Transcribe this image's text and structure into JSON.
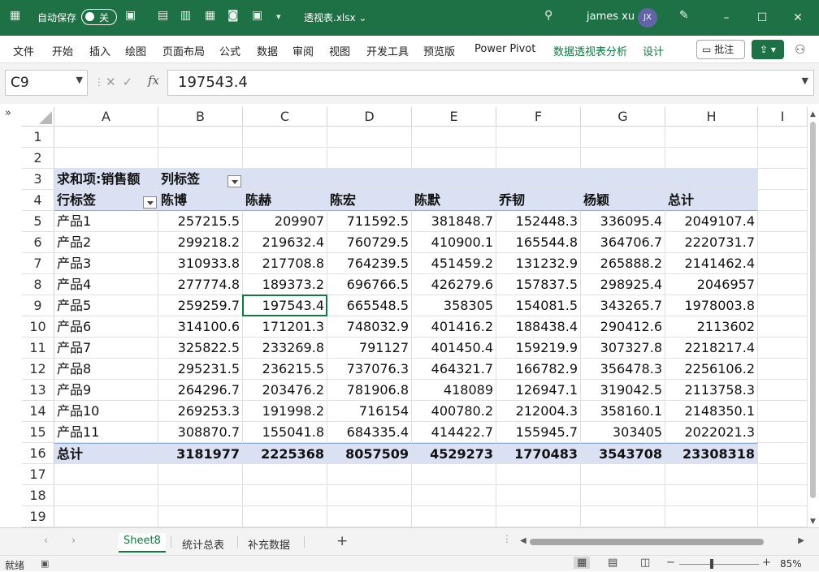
{
  "titlebar": {
    "autosave_label": "自动保存",
    "autosave_state": "关",
    "filename": "透视表.xlsx",
    "user_name": "james xu",
    "user_initials": "JX"
  },
  "ribbon": {
    "tabs": [
      "文件",
      "开始",
      "插入",
      "绘图",
      "页面布局",
      "公式",
      "数据",
      "审阅",
      "视图",
      "开发工具",
      "预览版",
      "Power Pivot"
    ],
    "context_tabs": [
      "数据透视表分析",
      "设计"
    ],
    "comment_label": "批注"
  },
  "formula_bar": {
    "name_box": "C9",
    "value": "197543.4",
    "fx_label": "fx"
  },
  "columns": [
    "A",
    "B",
    "C",
    "D",
    "E",
    "F",
    "G",
    "H",
    "I"
  ],
  "rows": [
    "1",
    "2",
    "3",
    "4",
    "5",
    "6",
    "7",
    "8",
    "9",
    "10",
    "11",
    "12",
    "13",
    "14",
    "15",
    "16",
    "17",
    "18",
    "19"
  ],
  "pivot": {
    "value_label": "求和项:销售额",
    "col_label": "列标签",
    "row_label": "行标签",
    "headers": [
      "陈博",
      "陈赫",
      "陈宏",
      "陈默",
      "乔韧",
      "杨颖",
      "总计"
    ],
    "body": [
      [
        "产品1",
        "257215.5",
        "209907",
        "711592.5",
        "381848.7",
        "152448.3",
        "336095.4",
        "2049107.4"
      ],
      [
        "产品2",
        "299218.2",
        "219632.4",
        "760729.5",
        "410900.1",
        "165544.8",
        "364706.7",
        "2220731.7"
      ],
      [
        "产品3",
        "310933.8",
        "217708.8",
        "764239.5",
        "451459.2",
        "131232.9",
        "265888.2",
        "2141462.4"
      ],
      [
        "产品4",
        "277774.8",
        "189373.2",
        "696766.5",
        "426279.6",
        "157837.5",
        "298925.4",
        "2046957"
      ],
      [
        "产品5",
        "259259.7",
        "197543.4",
        "665548.5",
        "358305",
        "154081.5",
        "343265.7",
        "1978003.8"
      ],
      [
        "产品6",
        "314100.6",
        "171201.3",
        "748032.9",
        "401416.2",
        "188438.4",
        "290412.6",
        "2113602"
      ],
      [
        "产品7",
        "325822.5",
        "233269.8",
        "791127",
        "401450.4",
        "159219.9",
        "307327.8",
        "2218217.4"
      ],
      [
        "产品8",
        "295231.5",
        "236215.5",
        "737076.3",
        "464321.7",
        "166782.9",
        "356478.3",
        "2256106.2"
      ],
      [
        "产品9",
        "264296.7",
        "203476.2",
        "781906.8",
        "418089",
        "126947.1",
        "319042.5",
        "2113758.3"
      ],
      [
        "产品10",
        "269253.3",
        "191998.2",
        "716154",
        "400780.2",
        "212004.3",
        "358160.1",
        "2148350.1"
      ],
      [
        "产品11",
        "308870.7",
        "155041.8",
        "684335.4",
        "414422.7",
        "155945.7",
        "303405",
        "2022021.3"
      ]
    ],
    "total_row": [
      "总计",
      "3181977",
      "2225368",
      "8057509",
      "4529273",
      "1770483",
      "3543708",
      "23308318"
    ]
  },
  "sheets": [
    "Sheet8",
    "统计总表",
    "补充数据"
  ],
  "active_sheet": "Sheet8",
  "statusbar": {
    "ready": "就绪",
    "zoom": "85%"
  },
  "colors": {
    "excel_green": "#1e7145",
    "pivot_header_fill": "#d9e1f2",
    "selection_border": "#107c41"
  }
}
